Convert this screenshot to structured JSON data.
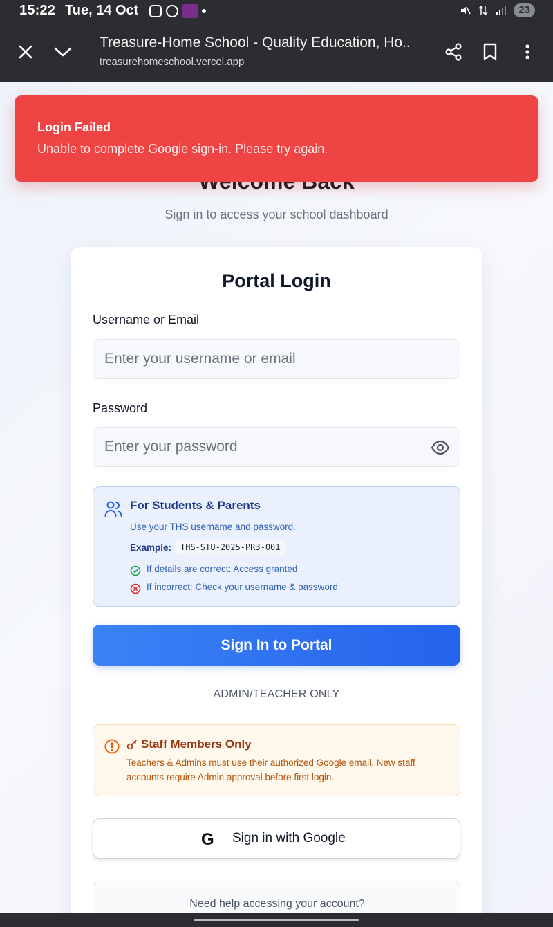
{
  "status": {
    "time": "15:22",
    "date": "Tue, 14 Oct",
    "battery": "23"
  },
  "browser": {
    "title": "Treasure-Home School - Quality Education, Ho...",
    "url": "treasurehomeschool.vercel.app"
  },
  "page": {
    "welcome": "Welcome Back",
    "subtitle": "Sign in to access your school dashboard"
  },
  "login": {
    "title": "Portal Login",
    "username_label": "Username or Email",
    "username_placeholder": "Enter your username or email",
    "password_label": "Password",
    "password_placeholder": "Enter your password",
    "submit_label": "Sign In to Portal"
  },
  "info": {
    "title": "For Students & Parents",
    "line": "Use your THS username and password.",
    "example_label": "Example:",
    "example_code": "THS-STU-2025-PR3-001",
    "success_text": "If details are correct: Access granted",
    "error_text": "If incorrect: Check your username & password"
  },
  "divider": "ADMIN/TEACHER ONLY",
  "staff": {
    "title": "Staff Members Only",
    "text": "Teachers & Admins must use their authorized Google email. New staff accounts require Admin approval before first login."
  },
  "google": {
    "label": "Sign in with Google",
    "glyph": "G"
  },
  "help": {
    "text": "Need help accessing your account?"
  },
  "toast": {
    "title": "Login Failed",
    "message": "Unable to complete Google sign-in. Please try again."
  },
  "colors": {
    "toast": "#ef4444",
    "primary": "#2563eb",
    "info_bg": "#eaf1fd",
    "warn_bg": "#fff8ec",
    "success": "#16a34a",
    "error": "#dc2626"
  }
}
